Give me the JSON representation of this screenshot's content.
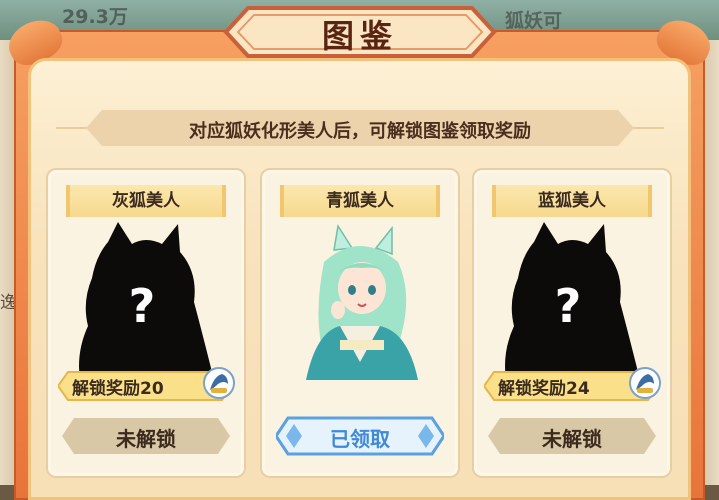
{
  "background": {
    "left_text": "29.3万",
    "right_text": "狐妖可",
    "side_char": "逸"
  },
  "dialog": {
    "title": "图鉴",
    "subtitle": "对应狐妖化形美人后，可解锁图鉴领取奖励"
  },
  "cards": [
    {
      "name": "灰狐美人",
      "portrait": "locked-silhouette",
      "reward_label": "解锁奖励20",
      "reward_icon": "fox-coin-icon",
      "button_label": "未解锁",
      "state": "locked"
    },
    {
      "name": "青狐美人",
      "portrait": "fox-beauty-portrait",
      "reward_label": "",
      "reward_icon": "",
      "button_label": "已领取",
      "state": "claimed"
    },
    {
      "name": "蓝狐美人",
      "portrait": "locked-silhouette",
      "reward_label": "解锁奖励24",
      "reward_icon": "fox-coin-icon",
      "button_label": "未解锁",
      "state": "locked"
    }
  ],
  "colors": {
    "frame_orange": "#e8743a",
    "panel_cream": "#f8e3bd",
    "claimed_blue": "#3f8ad8",
    "locked_btn": "#d8c8a8"
  }
}
